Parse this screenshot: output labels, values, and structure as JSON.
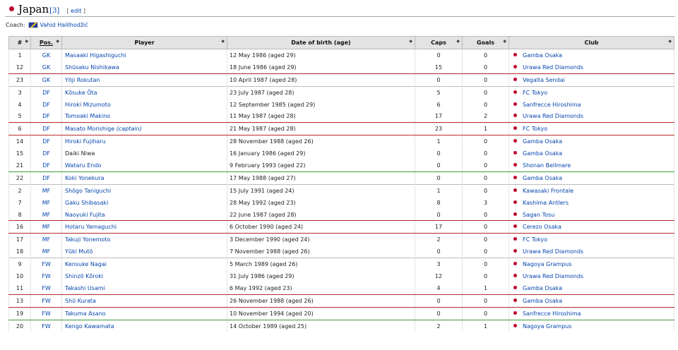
{
  "section": {
    "title": "Japan",
    "ref": "[3]",
    "edit_open": "[ ",
    "edit_label": "edit",
    "edit_close": " ]"
  },
  "coach": {
    "label": "Coach:",
    "name": "Vahid Halilhodžić"
  },
  "table": {
    "headers": [
      "#",
      "Pos.",
      "Player",
      "Date of birth (age)",
      "Caps",
      "Goals",
      "Club"
    ],
    "rows": [
      {
        "num": "1",
        "pos": "GK",
        "player": "Masaaki Higashiguchi",
        "dob": "12 May 1986 (aged 29)",
        "caps": "0",
        "goals": "0",
        "club": "Gamba Osaka"
      },
      {
        "num": "12",
        "pos": "GK",
        "player": "Shūsaku Nishikawa",
        "dob": "18 June 1986 (aged 29)",
        "caps": "15",
        "goals": "0",
        "club": "Urawa Red Diamonds"
      },
      {
        "num": "23",
        "pos": "GK",
        "player": "Yōji Rokutan",
        "dob": "10 April 1987 (aged 28)",
        "caps": "0",
        "goals": "0",
        "club": "Vegalta Sendai"
      },
      {
        "num": "3",
        "pos": "DF",
        "player": "Kōsuke Ōta",
        "dob": "23 July 1987 (aged 28)",
        "caps": "5",
        "goals": "0",
        "club": "FC Tokyo"
      },
      {
        "num": "4",
        "pos": "DF",
        "player": "Hiroki Mizumoto",
        "dob": "12 September 1985 (aged 29)",
        "caps": "6",
        "goals": "0",
        "club": "Sanfrecce Hiroshima"
      },
      {
        "num": "5",
        "pos": "DF",
        "player": "Tomoaki Makino",
        "dob": "11 May 1987 (aged 28)",
        "caps": "17",
        "goals": "2",
        "club": "Urawa Red Diamonds"
      },
      {
        "num": "6",
        "pos": "DF",
        "player": "Masato Morishige",
        "role": "(captain)",
        "dob": "21 May 1987 (aged 28)",
        "caps": "23",
        "goals": "1",
        "club": "FC Tokyo"
      },
      {
        "num": "14",
        "pos": "DF",
        "player": "Hiroki Fujiharu",
        "dob": "28 November 1988 (aged 26)",
        "caps": "1",
        "goals": "0",
        "club": "Gamba Osaka"
      },
      {
        "num": "15",
        "pos": "DF",
        "player": "Daiki Niwa",
        "dob": "16 January 1986 (aged 29)",
        "caps": "0",
        "goals": "0",
        "club": "Gamba Osaka"
      },
      {
        "num": "21",
        "pos": "DF",
        "player": "Wataru Endo",
        "dob": "9 February 1993 (aged 22)",
        "caps": "0",
        "goals": "0",
        "club": "Shonan Bellmare"
      },
      {
        "num": "22",
        "pos": "DF",
        "player": "Koki Yonekura",
        "dob": "17 May 1988 (aged 27)",
        "caps": "0",
        "goals": "0",
        "club": "Gamba Osaka"
      },
      {
        "num": "2",
        "pos": "MF",
        "player": "Shōgo Taniguchi",
        "dob": "15 July 1991 (aged 24)",
        "caps": "1",
        "goals": "0",
        "club": "Kawasaki Frontale"
      },
      {
        "num": "7",
        "pos": "MF",
        "player": "Gaku Shibasaki",
        "dob": "28 May 1992 (aged 23)",
        "caps": "8",
        "goals": "3",
        "club": "Kashima Antlers"
      },
      {
        "num": "8",
        "pos": "MF",
        "player": "Naoyuki Fujita",
        "dob": "22 June 1987 (aged 28)",
        "caps": "0",
        "goals": "0",
        "club": "Sagan Tosu"
      },
      {
        "num": "16",
        "pos": "MF",
        "player": "Hotaru Yamaguchi",
        "dob": "6 October 1990 (aged 24)",
        "caps": "17",
        "goals": "0",
        "club": "Cerezo Osaka"
      },
      {
        "num": "17",
        "pos": "MF",
        "player": "Takuji Yonemoto",
        "dob": "3 December 1990 (aged 24)",
        "caps": "2",
        "goals": "0",
        "club": "FC Tokyo"
      },
      {
        "num": "18",
        "pos": "MF",
        "player": "Yūki Mutō",
        "dob": "7 November 1988 (aged 26)",
        "caps": "0",
        "goals": "0",
        "club": "Urawa Red Diamonds"
      },
      {
        "num": "9",
        "pos": "FW",
        "player": "Kensuke Nagai",
        "dob": "5 March 1989 (aged 26)",
        "caps": "3",
        "goals": "0",
        "club": "Nagoya Grampus"
      },
      {
        "num": "10",
        "pos": "FW",
        "player": "Shinzō Kōroki",
        "dob": "31 July 1986 (aged 29)",
        "caps": "12",
        "goals": "0",
        "club": "Urawa Red Diamonds"
      },
      {
        "num": "11",
        "pos": "FW",
        "player": "Takashi Usami",
        "dob": "6 May 1992 (aged 23)",
        "caps": "4",
        "goals": "1",
        "club": "Gamba Osaka"
      },
      {
        "num": "13",
        "pos": "FW",
        "player": "Shū Kurata",
        "dob": "26 November 1988 (aged 26)",
        "caps": "0",
        "goals": "0",
        "club": "Gamba Osaka"
      },
      {
        "num": "19",
        "pos": "FW",
        "player": "Takuma Asano",
        "dob": "10 November 1994 (aged 20)",
        "caps": "0",
        "goals": "0",
        "club": "Sanfrecce Hiroshima"
      },
      {
        "num": "20",
        "pos": "FW",
        "player": "Kengo Kawamata",
        "dob": "14 October 1989 (aged 25)",
        "caps": "2",
        "goals": "1",
        "club": "Nagoya Grampus"
      }
    ]
  },
  "colors": {
    "japan_red": "#bc002d",
    "link": "#0645ad",
    "header_bg": "#e3e3e3"
  },
  "icons": {
    "sort": "sort-arrows-icon",
    "flag": "japan-flag-icon",
    "coach_flag": "bosnia-flag-icon"
  }
}
